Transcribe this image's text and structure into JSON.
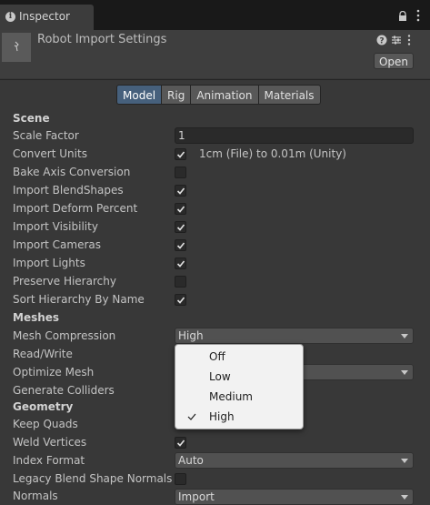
{
  "window": {
    "tab_title": "Inspector"
  },
  "header": {
    "asset_title": "Robot Import Settings",
    "open_label": "Open"
  },
  "tabs": [
    {
      "label": "Model",
      "active": true
    },
    {
      "label": "Rig",
      "active": false
    },
    {
      "label": "Animation",
      "active": false
    },
    {
      "label": "Materials",
      "active": false
    }
  ],
  "sections": {
    "scene": "Scene",
    "meshes": "Meshes",
    "geometry": "Geometry"
  },
  "labels": {
    "scale_factor": "Scale Factor",
    "convert_units": "Convert Units",
    "bake_axis": "Bake Axis Conversion",
    "import_blendshapes": "Import BlendShapes",
    "import_deform_percent": "Import Deform Percent",
    "import_visibility": "Import Visibility",
    "import_cameras": "Import Cameras",
    "import_lights": "Import Lights",
    "preserve_hierarchy": "Preserve Hierarchy",
    "sort_hierarchy": "Sort Hierarchy By Name",
    "mesh_compression": "Mesh Compression",
    "read_write": "Read/Write",
    "optimize_mesh": "Optimize Mesh",
    "generate_colliders": "Generate Colliders",
    "keep_quads": "Keep Quads",
    "weld_vertices": "Weld Vertices",
    "index_format": "Index Format",
    "legacy_blend": "Legacy Blend Shape Normals",
    "normals": "Normals"
  },
  "values": {
    "scale_factor": "1",
    "convert_units_note": "1cm (File) to 0.01m (Unity)",
    "mesh_compression": "High",
    "index_format": "Auto",
    "normals": "Import"
  },
  "checkboxes": {
    "convert_units": true,
    "bake_axis": false,
    "import_blendshapes": true,
    "import_deform_percent": true,
    "import_visibility": true,
    "import_cameras": true,
    "import_lights": true,
    "preserve_hierarchy": false,
    "sort_hierarchy": true,
    "weld_vertices": true,
    "legacy_blend": false
  },
  "dropdown_popup": {
    "options": [
      "Off",
      "Low",
      "Medium",
      "High"
    ],
    "selected": "High"
  }
}
